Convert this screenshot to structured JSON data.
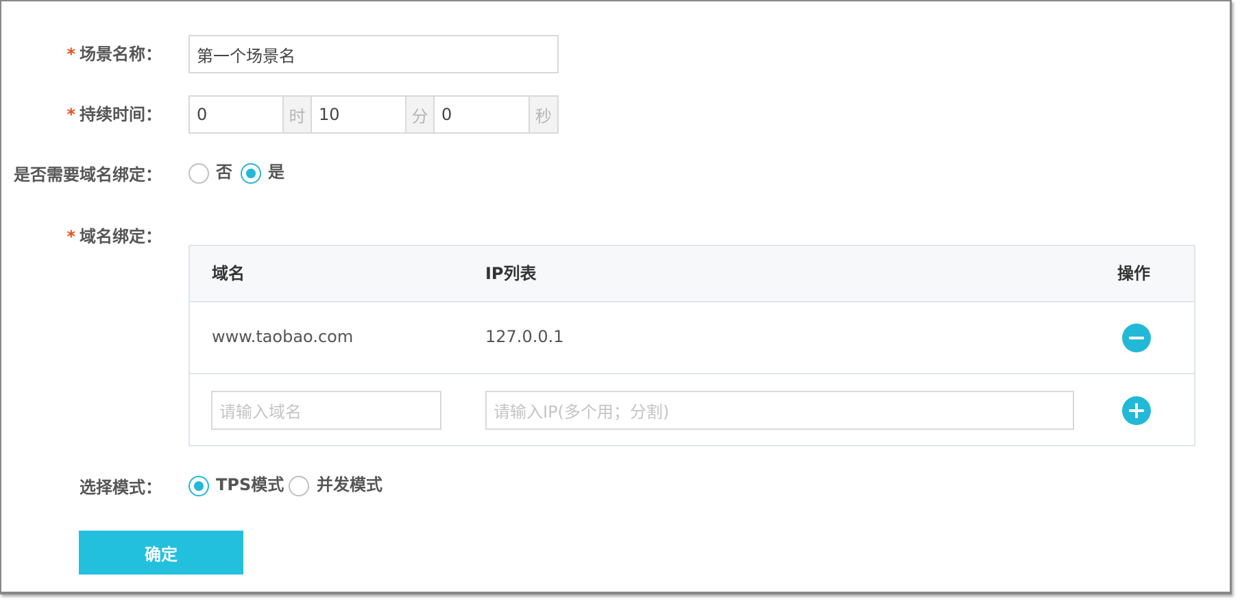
{
  "form": {
    "scene_name": {
      "label": "场景名称：",
      "required": "*",
      "value": "第一个场景名"
    },
    "duration": {
      "label": "持续时间：",
      "required": "*",
      "hours_value": "0",
      "hours_unit": "时",
      "minutes_value": "10",
      "minutes_unit": "分",
      "seconds_value": "0",
      "seconds_unit": "秒"
    },
    "domain_binding_toggle": {
      "label": "是否需要域名绑定：",
      "options": [
        {
          "label": "否",
          "selected": false
        },
        {
          "label": "是",
          "selected": true
        }
      ]
    },
    "domain_binding": {
      "label": "域名绑定：",
      "required": "*",
      "columns": [
        "域名",
        "IP列表",
        "操作"
      ],
      "rows": [
        {
          "domain": "www.taobao.com",
          "ip": "127.0.0.1",
          "action_icon": "minus-circle-icon"
        }
      ],
      "new_row": {
        "domain_placeholder": "请输入域名",
        "ip_placeholder": "请输入IP(多个用；分割)",
        "action_icon": "plus-circle-icon"
      }
    },
    "mode": {
      "label": "选择模式：",
      "options": [
        {
          "label": "TPS模式",
          "selected": true
        },
        {
          "label": "并发模式",
          "selected": false
        }
      ]
    },
    "submit_label": "确定"
  },
  "colors": {
    "accent": "#22b8d8",
    "button": "#23c0dd",
    "required": "#e8501d"
  }
}
